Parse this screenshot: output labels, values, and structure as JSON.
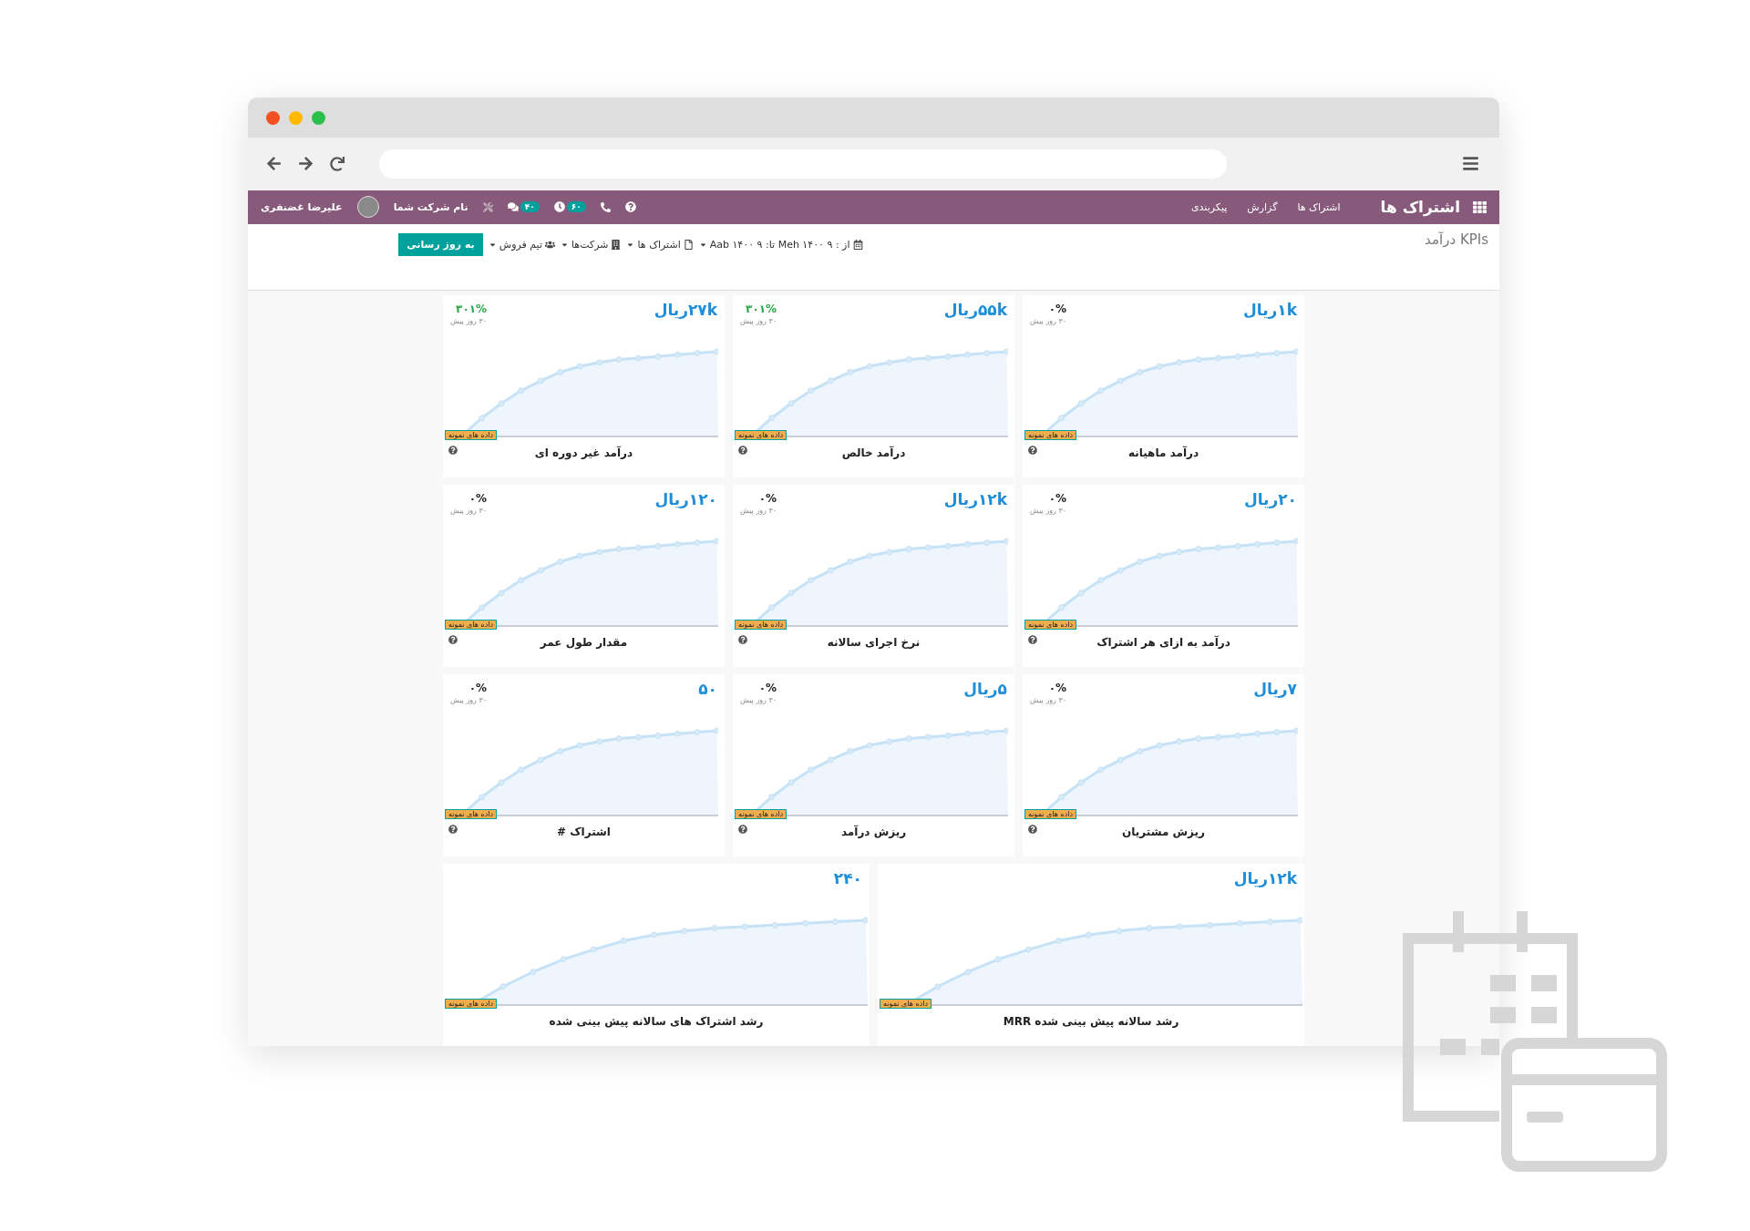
{
  "navbar": {
    "app_title": "اشتراک ها",
    "menu": [
      "اشتراک ها",
      "گزارش",
      "پیکربندی"
    ],
    "activity_count": "۶۰",
    "message_count": "۴۰",
    "company": "نام شرکت شما",
    "user": "علیرضا غضنفری"
  },
  "control_panel": {
    "title": "KPIs درآمد",
    "filters": [
      {
        "kind": "date",
        "label": "از : ۹ Meh ۱۴۰۰ تا: ۹ Aab ۱۴۰۰"
      },
      {
        "kind": "document",
        "label": "اشتراک ها"
      },
      {
        "kind": "company",
        "label": "شرکت‌ها"
      },
      {
        "kind": "team",
        "label": "تیم فروش"
      }
    ],
    "refresh_button": "به روز رسانی"
  },
  "cards": [
    {
      "kind": "small",
      "title": "درآمد ماهیانه",
      "value": "۱kریال",
      "percent": "۰%",
      "color": "#222222",
      "period": "۳۰ روز پیش",
      "badge": "داده های نمونه"
    },
    {
      "kind": "small",
      "title": "درآمد خالص",
      "value": "۵۵kریال",
      "percent": "۳۰۱%",
      "color": "#28a745",
      "period": "۳۰ روز پیش",
      "badge": "داده های نمونه"
    },
    {
      "kind": "small",
      "title": "درآمد غیر دوره ای",
      "value": "۲۷kریال",
      "percent": "۳۰۱%",
      "color": "#28a745",
      "period": "۳۰ روز پیش",
      "badge": "داده های نمونه"
    },
    {
      "kind": "small",
      "title": "درآمد به ازای هر اشتراک",
      "value": "۲۰ریال",
      "percent": "۰%",
      "color": "#222222",
      "period": "۳۰ روز پیش",
      "badge": "داده های نمونه"
    },
    {
      "kind": "small",
      "title": "نرخ اجرای سالانه",
      "value": "۱۲kریال",
      "percent": "۰%",
      "color": "#222222",
      "period": "۳۰ روز پیش",
      "badge": "داده های نمونه"
    },
    {
      "kind": "small",
      "title": "مقدار طول عمر",
      "value": "۱۲۰ریال",
      "percent": "۰%",
      "color": "#222222",
      "period": "۳۰ روز پیش",
      "badge": "داده های نمونه"
    },
    {
      "kind": "small",
      "title": "ریزش مشتریان",
      "value": "۷ریال",
      "percent": "۰%",
      "color": "#222222",
      "period": "۳۰ روز پیش",
      "badge": "داده های نمونه"
    },
    {
      "kind": "small",
      "title": "ریزش درآمد",
      "value": "۵ریال",
      "percent": "۰%",
      "color": "#222222",
      "period": "۳۰ روز پیش",
      "badge": "داده های نمونه"
    },
    {
      "kind": "small",
      "title": "اشتراک #",
      "value": "۵۰",
      "percent": "۰%",
      "color": "#222222",
      "period": "۳۰ روز پیش",
      "badge": "داده های نمونه"
    },
    {
      "kind": "wide",
      "title": "رشد سالانه پیش بینی شده MRR",
      "value": "۱۲kریال",
      "badge": "داده های نمونه"
    },
    {
      "kind": "wide",
      "title": "رشد اشتراک های سالانه پیش بینی شده",
      "value": "۲۴۰",
      "badge": "داده های نمونه"
    }
  ]
}
